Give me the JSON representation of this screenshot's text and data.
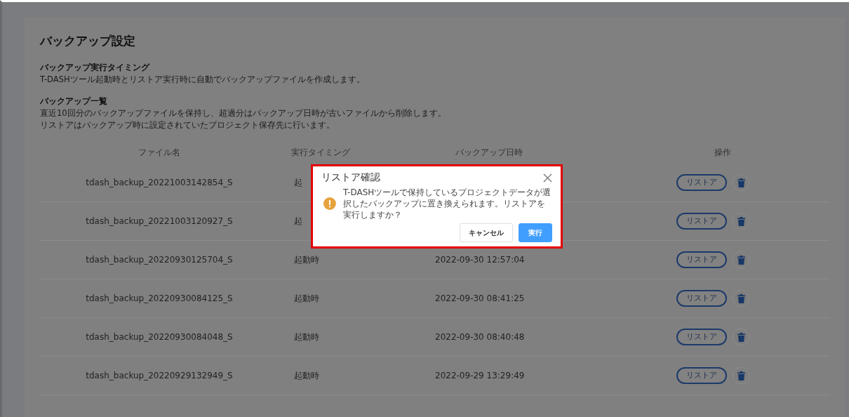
{
  "page": {
    "title": "バックアップ設定"
  },
  "sections": [
    {
      "heading": "バックアップ実行タイミング",
      "lines": [
        "T-DASHツール起動時とリストア実行時に自動でバックアップファイルを作成します。"
      ]
    },
    {
      "heading": "バックアップ一覧",
      "lines": [
        "直近10回分のバックアップファイルを保持し、超過分はバックアップ日時が古いファイルから削除します。",
        "リストアはバックアップ時に設定されていたプロジェクト保存先に行います。"
      ]
    }
  ],
  "table": {
    "columns": [
      "ファイル名",
      "実行タイミング",
      "バックアップ日時",
      "操作"
    ],
    "rows": [
      {
        "file": "tdash_backup_20221003142854_S",
        "timing": "起",
        "restore": "リストア"
      },
      {
        "file": "tdash_backup_20221003120927_S",
        "timing": "起",
        "restore": "リストア"
      },
      {
        "file": "tdash_backup_20220930125704_S",
        "timing": "起動時",
        "date": "2022-09-30 12:57:04",
        "restore": "リストア"
      },
      {
        "file": "tdash_backup_20220930084125_S",
        "timing": "起動時",
        "date": "2022-09-30 08:41:25",
        "restore": "リストア"
      },
      {
        "file": "tdash_backup_20220930084048_S",
        "timing": "起動時",
        "date": "2022-09-30 08:40:48",
        "restore": "リストア"
      },
      {
        "file": "tdash_backup_20220929132949_S",
        "timing": "起動時",
        "date": "2022-09-29 13:29:49",
        "restore": "リストア"
      }
    ]
  },
  "dialog": {
    "title": "リストア確認",
    "message": "T-DASHツールで保持しているプロジェクトデータが選択したバックアップに置き換えられます。リストアを実行しますか？",
    "buttons": [
      {
        "label": "キャンセル",
        "kind": "secondary"
      },
      {
        "label": "実行",
        "kind": "primary"
      }
    ]
  }
}
